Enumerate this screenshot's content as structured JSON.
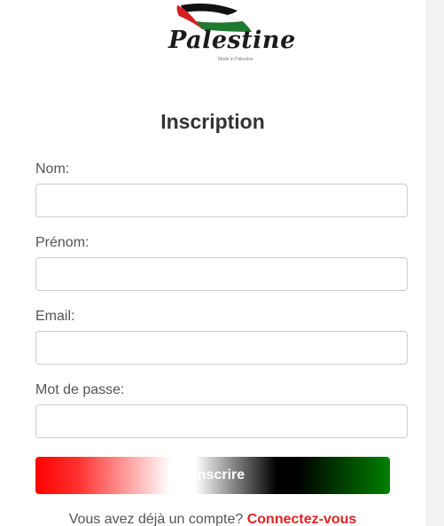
{
  "logo": {
    "wordmark": "Palestine",
    "tagline": "Made in Palestine"
  },
  "form": {
    "title": "Inscription",
    "fields": [
      {
        "label": "Nom:",
        "value": "",
        "placeholder": ""
      },
      {
        "label": "Prénom:",
        "value": "",
        "placeholder": ""
      },
      {
        "label": "Email:",
        "value": "",
        "placeholder": ""
      },
      {
        "label": "Mot de passe:",
        "value": "",
        "placeholder": ""
      }
    ],
    "submit_label": "S'inscrire"
  },
  "footer": {
    "prompt": "Vous avez déjà un compte?",
    "link_label": "Connectez-vous"
  },
  "colors": {
    "flag_red": "#e02424",
    "flag_green": "#1e7a2e",
    "flag_black": "#000000",
    "link": "#e02424"
  }
}
